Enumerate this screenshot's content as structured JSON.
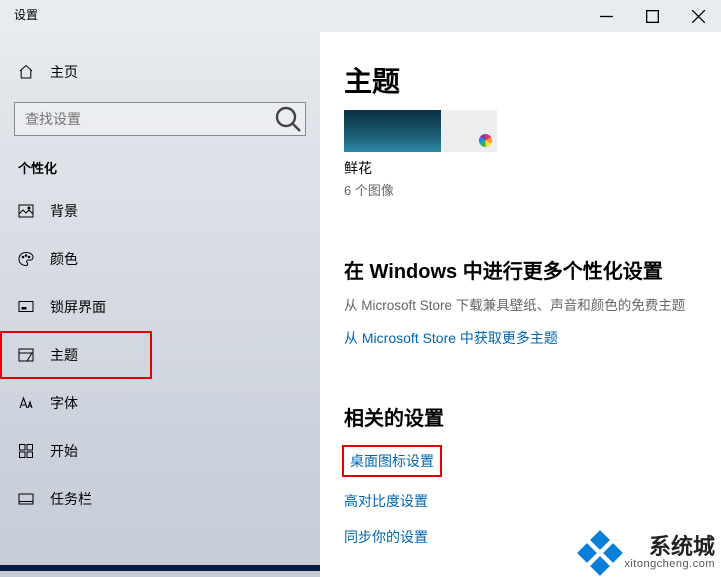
{
  "window": {
    "title": "设置"
  },
  "sidebar": {
    "home": "主页",
    "search_placeholder": "查找设置",
    "section": "个性化",
    "items": [
      {
        "label": "背景"
      },
      {
        "label": "颜色"
      },
      {
        "label": "锁屏界面"
      },
      {
        "label": "主题"
      },
      {
        "label": "字体"
      },
      {
        "label": "开始"
      },
      {
        "label": "任务栏"
      }
    ]
  },
  "main": {
    "title": "主题",
    "theme": {
      "name": "鲜花",
      "count": "6 个图像"
    },
    "more": {
      "heading": "在 Windows 中进行更多个性化设置",
      "desc": "从 Microsoft Store 下载兼具壁纸、声音和颜色的免费主题",
      "link": "从 Microsoft Store 中获取更多主题"
    },
    "related": {
      "heading": "相关的设置",
      "links": [
        "桌面图标设置",
        "高对比度设置",
        "同步你的设置"
      ]
    }
  },
  "watermark": {
    "name": "系统城",
    "url": "xitongcheng.com"
  }
}
